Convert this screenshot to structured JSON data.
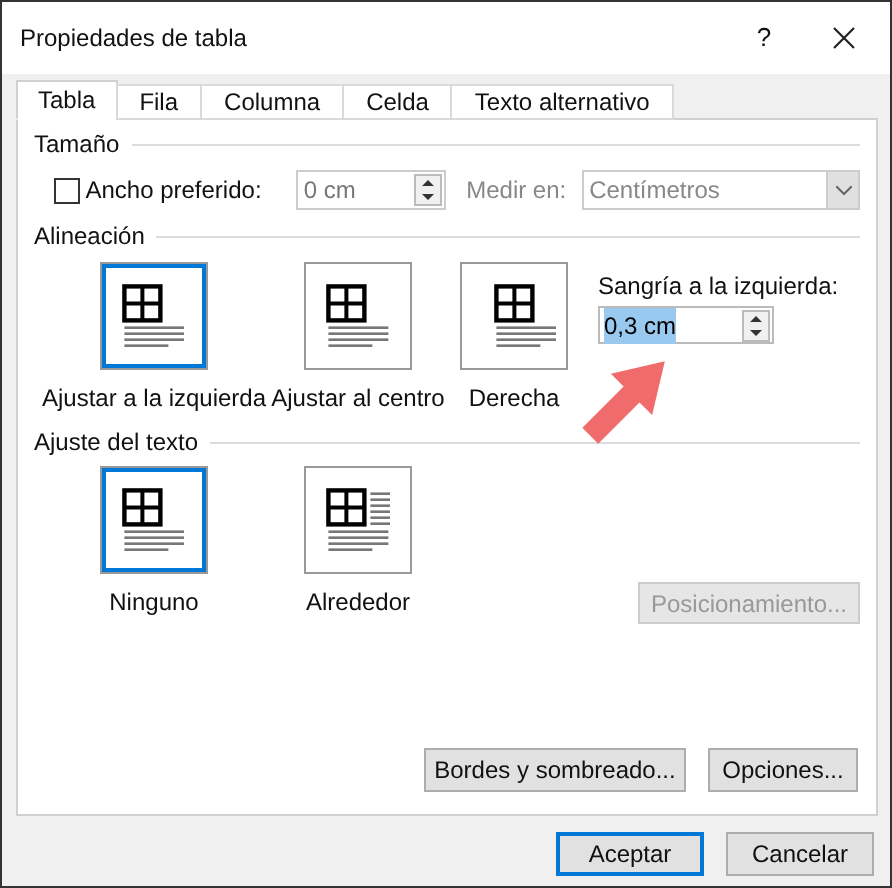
{
  "window": {
    "title": "Propiedades de tabla",
    "help": "?"
  },
  "tabs": [
    {
      "label": "Tabla",
      "selected": true
    },
    {
      "label": "Fila",
      "selected": false
    },
    {
      "label": "Columna",
      "selected": false
    },
    {
      "label": "Celda",
      "selected": false
    },
    {
      "label": "Texto alternativo",
      "selected": false
    }
  ],
  "size": {
    "heading": "Tamaño",
    "preferred_width": {
      "label": "Ancho preferido:",
      "checked": false,
      "value": "0 cm",
      "disabled": true
    },
    "measure_in": {
      "label": "Medir en:",
      "value": "Centímetros",
      "disabled": true
    }
  },
  "alignment": {
    "heading": "Alineación",
    "options": [
      {
        "label": "Ajustar a la izquierda",
        "kind": "left",
        "selected": true
      },
      {
        "label": "Ajustar al centro",
        "kind": "center",
        "selected": false
      },
      {
        "label": "Derecha",
        "kind": "right",
        "selected": false
      }
    ],
    "indent": {
      "label": "Sangría a la izquierda:",
      "value": "0,3 cm",
      "text_selected": true
    }
  },
  "text_wrapping": {
    "heading": "Ajuste del texto",
    "options": [
      {
        "label": "Ninguno",
        "kind": "none",
        "selected": true
      },
      {
        "label": "Alrededor",
        "kind": "around",
        "selected": false
      }
    ],
    "positioning_button": {
      "label": "Posicionamiento...",
      "disabled": true
    }
  },
  "buttons": [
    {
      "label": "Bordes y sombreado..."
    },
    {
      "label": "Opciones..."
    }
  ],
  "footer_buttons": [
    {
      "label": "Aceptar",
      "default": true
    },
    {
      "label": "Cancelar",
      "default": false
    }
  ]
}
